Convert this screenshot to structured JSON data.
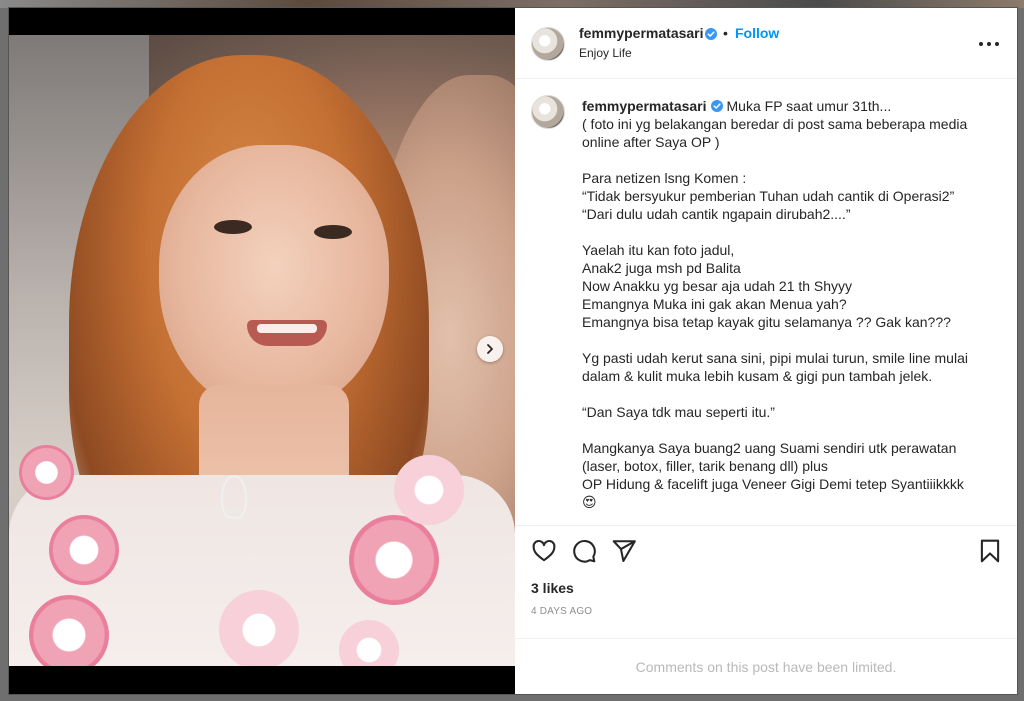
{
  "post": {
    "username": "femmypermatasari",
    "follow_label": "Follow",
    "separator": "•",
    "subtitle": "Enjoy Life",
    "caption_lines": [
      "Muka FP saat umur 31th...",
      "( foto ini yg belakangan beredar di post sama beberapa media online after Saya OP )",
      "",
      "Para netizen lsng Komen :",
      "“Tidak bersyukur pemberian Tuhan udah cantik di Operasi2”",
      "“Dari dulu udah cantik ngapain dirubah2....”",
      "",
      "Yaelah itu kan foto jadul,",
      "Anak2 juga msh pd Balita",
      "Now Anakku yg besar aja udah 21 th Shyyy",
      "Emangnya Muka ini gak akan Menua yah?",
      "Emangnya bisa tetap kayak gitu selamanya ?? Gak kan???",
      "",
      "Yg pasti udah kerut sana sini, pipi mulai turun, smile line mulai dalam & kulit muka lebih kusam & gigi pun tambah jelek.",
      "",
      "“Dan Saya tdk mau seperti itu.”",
      "",
      "Mangkanya Saya buang2 uang Suami sendiri utk perawatan (laser, botox, filler, tarik benang dll) plus",
      "OP Hidung & facelift juga Veneer Gigi Demi tetep Syantiiikkkk",
      "😍"
    ],
    "likes": "3 likes",
    "timestamp": "4 DAYS AGO",
    "comments_notice": "Comments on this post have been limited."
  },
  "colors": {
    "accent_blue": "#0095f6",
    "text": "#262626",
    "muted": "#8e8e8e",
    "verified": "#3897f0"
  },
  "icons": [
    "verified-badge-icon",
    "more-options-icon",
    "heart-icon",
    "comment-icon",
    "share-icon",
    "bookmark-icon",
    "chevron-right-icon"
  ]
}
